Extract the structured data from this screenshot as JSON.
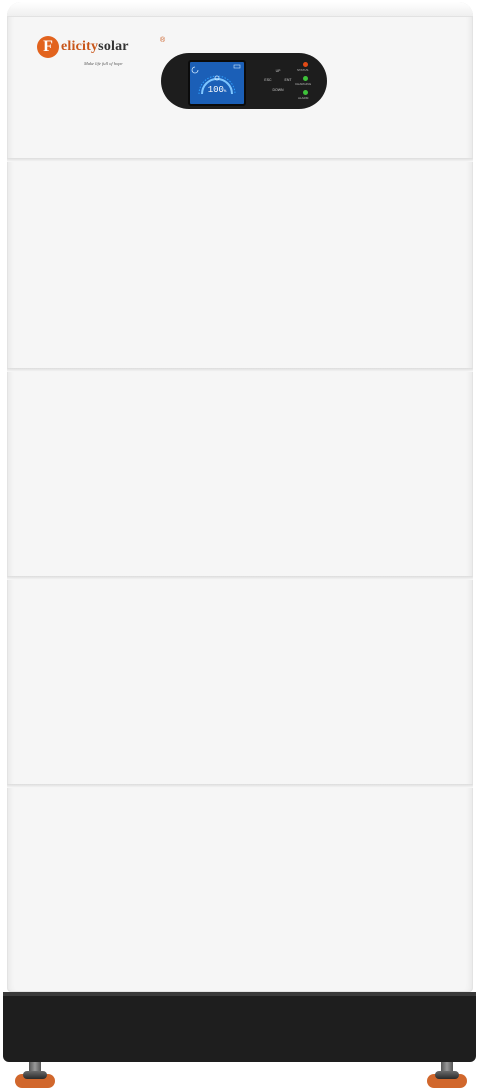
{
  "brand": {
    "initial": "F",
    "name_part1": "elicity",
    "name_part2": "solar",
    "registered": "®",
    "tagline": "Make life full of hope"
  },
  "display": {
    "value": "100",
    "unit": "%"
  },
  "buttons": {
    "up": "UP",
    "esc": "ESC",
    "ent": "ENT",
    "down": "DOWN"
  },
  "indicators": [
    {
      "label": "STATUS",
      "color": "#e24a16"
    },
    {
      "label": "CHARGING",
      "color": "#3ec23a"
    },
    {
      "label": "ALARM",
      "color": "#3ec23a"
    }
  ],
  "colors": {
    "brand_orange": "#e2631e",
    "screen_blue": "#1b5fb7",
    "body": "#f6f6f6",
    "base": "#1e1e1e",
    "foot_pad": "#d1672c"
  }
}
